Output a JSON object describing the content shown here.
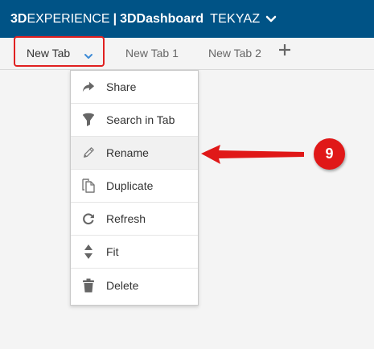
{
  "topbar": {
    "brand_3d": "3D",
    "brand_experience": "EXPERIENCE",
    "separator": "|",
    "dashboard_3d": "3D",
    "dashboard_name": "Dashboard",
    "tenant": "TEKYAZ"
  },
  "tabs": [
    {
      "label": "New Tab",
      "active": true
    },
    {
      "label": "New Tab 1",
      "active": false
    },
    {
      "label": "New Tab 2",
      "active": false
    }
  ],
  "menu": {
    "items": [
      {
        "label": "Share",
        "icon": "share-icon"
      },
      {
        "label": "Search in Tab",
        "icon": "filter-icon"
      },
      {
        "label": "Rename",
        "icon": "pencil-icon",
        "highlighted": true
      },
      {
        "label": "Duplicate",
        "icon": "duplicate-icon"
      },
      {
        "label": "Refresh",
        "icon": "refresh-icon"
      },
      {
        "label": "Fit",
        "icon": "fit-icon"
      },
      {
        "label": "Delete",
        "icon": "trash-icon"
      }
    ]
  },
  "callout": {
    "number": "9"
  },
  "colors": {
    "topbar": "#005386",
    "accent": "#e02020",
    "chevron": "#3d8bd6"
  }
}
